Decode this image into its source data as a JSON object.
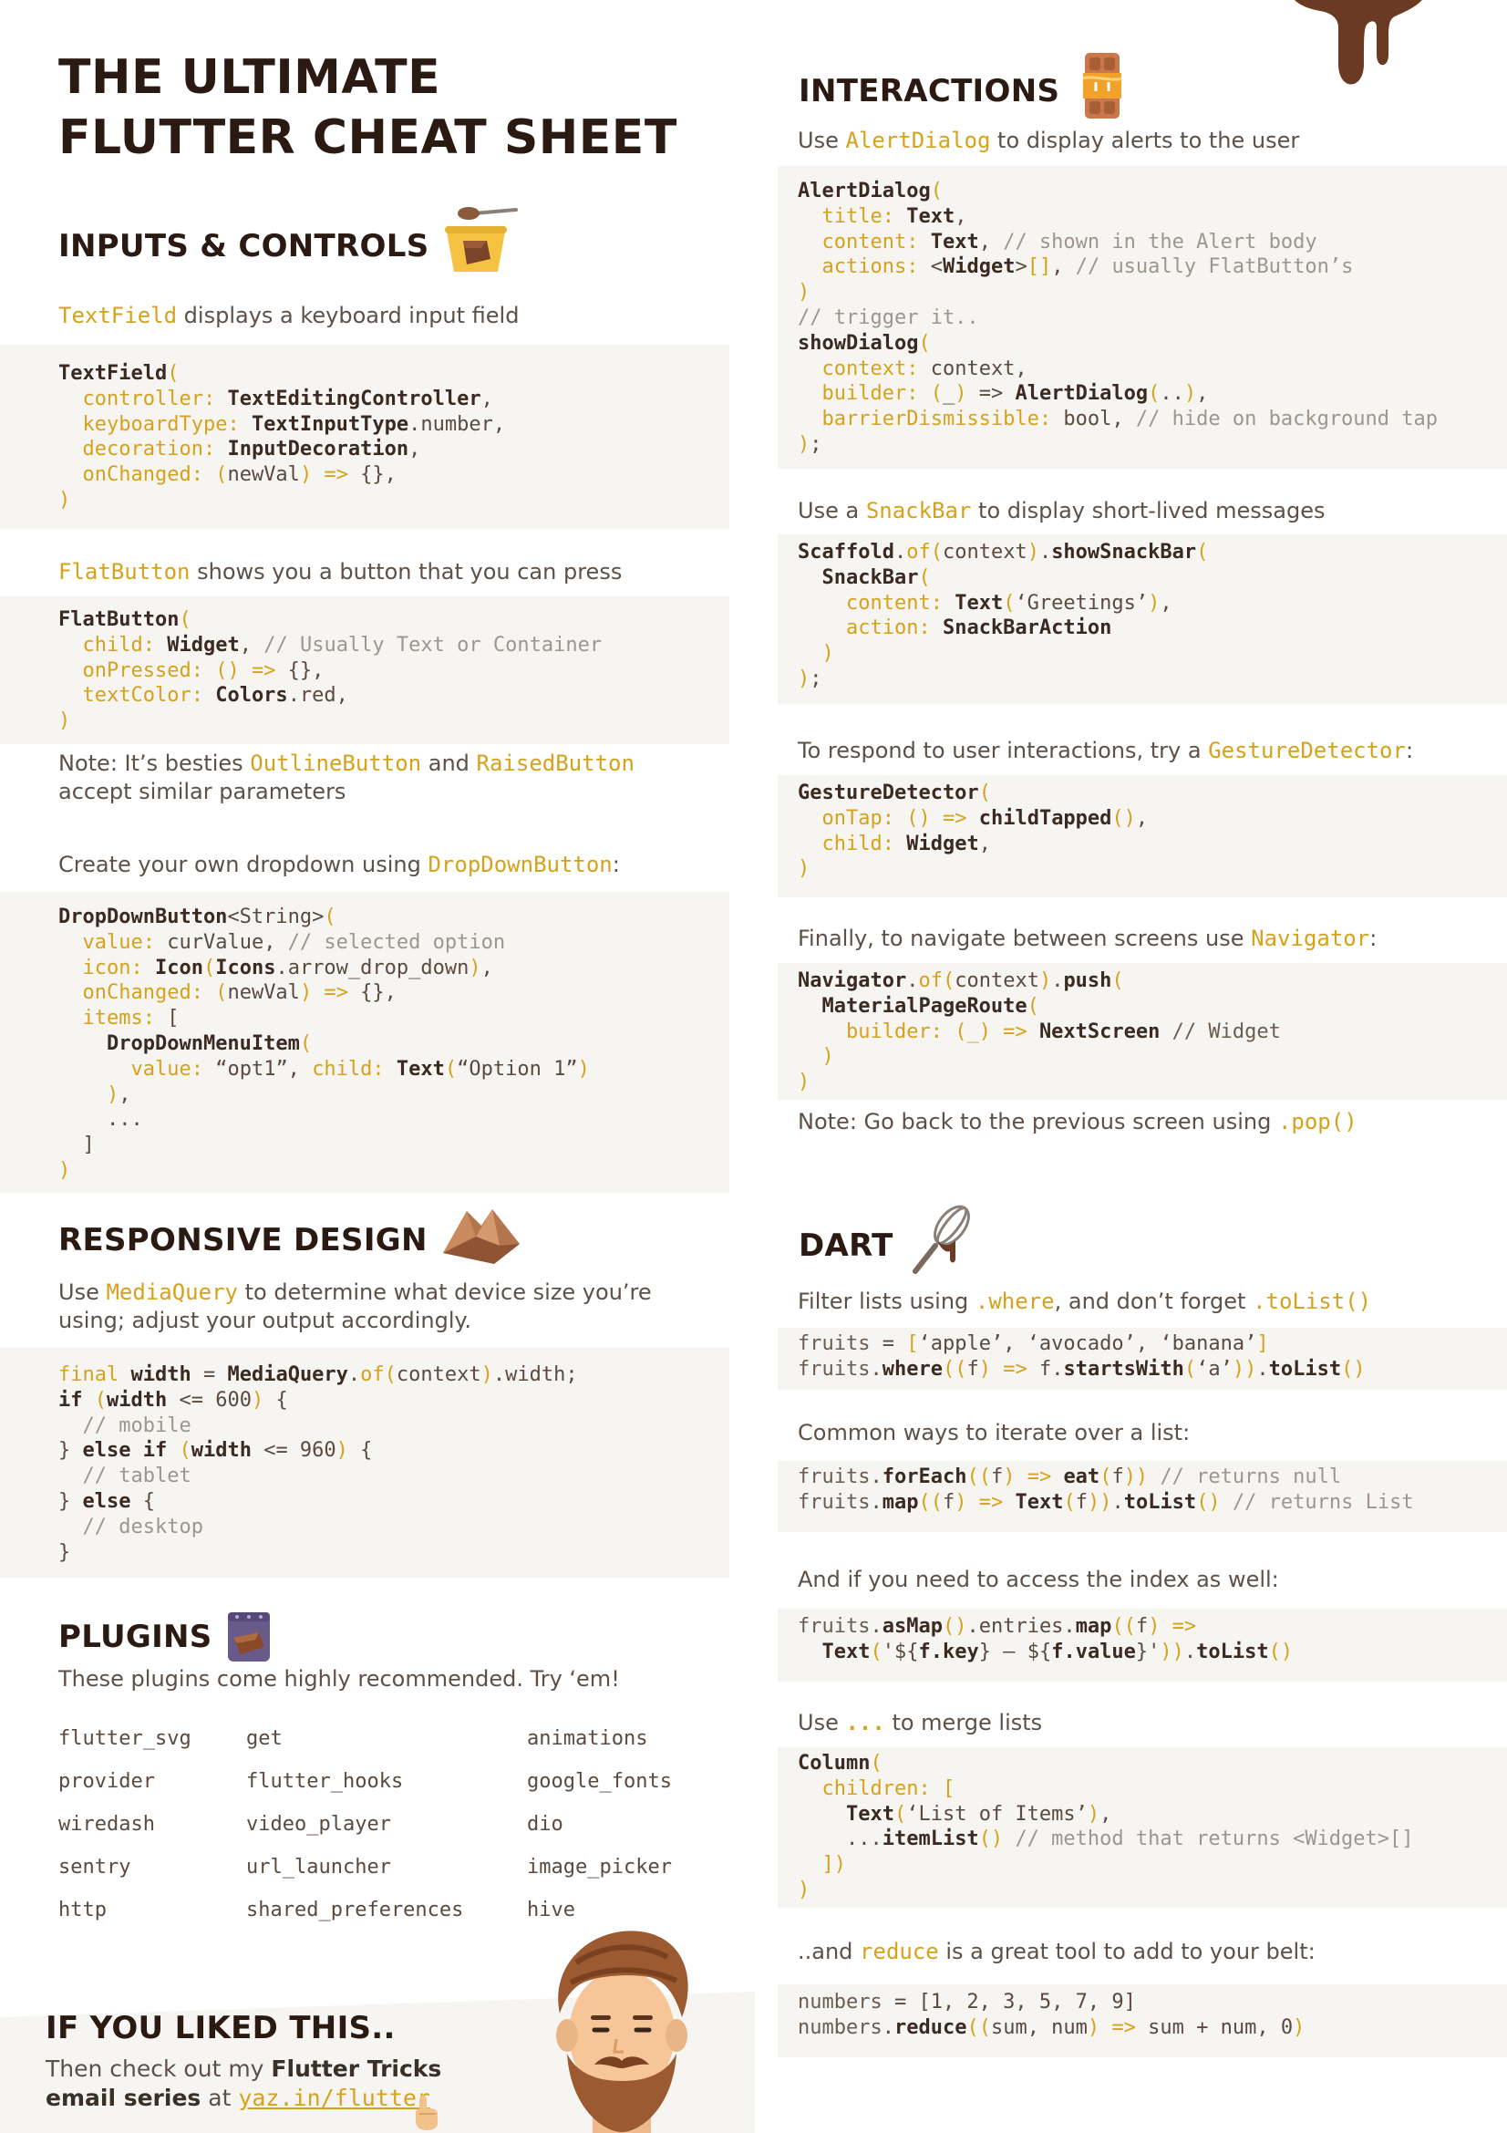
{
  "title": {
    "line1": "THE ULTIMATE",
    "line2": "FLUTTER CHEAT SHEET"
  },
  "left": {
    "inputs": {
      "heading": "INPUTS & CONTROLS",
      "textfield_kw": "TextField",
      "textfield_desc": " displays a keyboard input field",
      "flatbutton_kw": "FlatButton",
      "flatbutton_desc": " shows you a button that you can press",
      "note_pre": "Note: It’s besties ",
      "note_kw1": "OutlineButton",
      "note_mid": " and ",
      "note_kw2": "RaisedButton",
      "note_line2": "accept similar parameters",
      "dropdown_pre": "Create your own dropdown using ",
      "dropdown_kw": "DropDownButton",
      "dropdown_post": ":"
    },
    "responsive": {
      "heading": "RESPONSIVE DESIGN",
      "desc_pre": "Use ",
      "desc_kw": "MediaQuery",
      "desc_post": " to determine what device size you’re",
      "desc_line2": "using; adjust your output accordingly."
    },
    "plugins": {
      "heading": "PLUGINS",
      "desc": "These plugins come highly recommended. Try ‘em!",
      "col1": [
        "flutter_svg",
        "provider",
        "wiredash",
        "sentry",
        "http"
      ],
      "col2": [
        "get",
        "flutter_hooks",
        "video_player",
        "url_launcher",
        "shared_preferences"
      ],
      "col3": [
        "animations",
        "google_fonts",
        "dio",
        "image_picker",
        "hive"
      ]
    },
    "liked": {
      "heading": "IF YOU LIKED THIS..",
      "line1_pre": "Then check out my ",
      "line1_strong": "Flutter Tricks",
      "line2_strong": "email series",
      "line2_mid": " at ",
      "link": "yaz.in/flutter"
    }
  },
  "right": {
    "interactions": {
      "heading": "INTERACTIONS",
      "alert_pre": "Use ",
      "alert_kw": "AlertDialog",
      "alert_post": " to display alerts to the user",
      "snack_pre": "Use a ",
      "snack_kw": "SnackBar",
      "snack_post": " to display short-lived messages",
      "gesture_pre": "To respond to user interactions, try a ",
      "gesture_kw": "GestureDetector",
      "gesture_post": ":",
      "nav_pre": "Finally, to navigate between screens use ",
      "nav_kw": "Navigator",
      "nav_post": ":",
      "pop_pre": "Note: Go back to the previous screen using ",
      "pop_kw": ".pop()"
    },
    "dart": {
      "heading": "DART",
      "filter_pre": "Filter lists using ",
      "filter_kw1": ".where",
      "filter_mid": ", and don’t forget ",
      "filter_kw2": ".toList()",
      "iterate": "Common ways to iterate over a list:",
      "index": "And if you need to access the index as well:",
      "merge_pre": "Use ",
      "merge_kw": "...",
      "merge_post": " to merge lists",
      "reduce_pre": "..and  ",
      "reduce_kw": "reduce",
      "reduce_post": " is a great tool to add to your belt:"
    }
  },
  "colors": {
    "accent": "#d6a21c",
    "heading": "#2a1a12",
    "code_bg": "#f7f5f2",
    "chocolate": "#6b3a22"
  },
  "icons": [
    "pudding-cup-icon",
    "chocolate-wedge-icon",
    "chocolate-bar-icon",
    "chocolate-bag-icon",
    "whisk-icon",
    "chocolate-drip-icon",
    "bearded-man-avatar",
    "pointing-hand-icon"
  ]
}
